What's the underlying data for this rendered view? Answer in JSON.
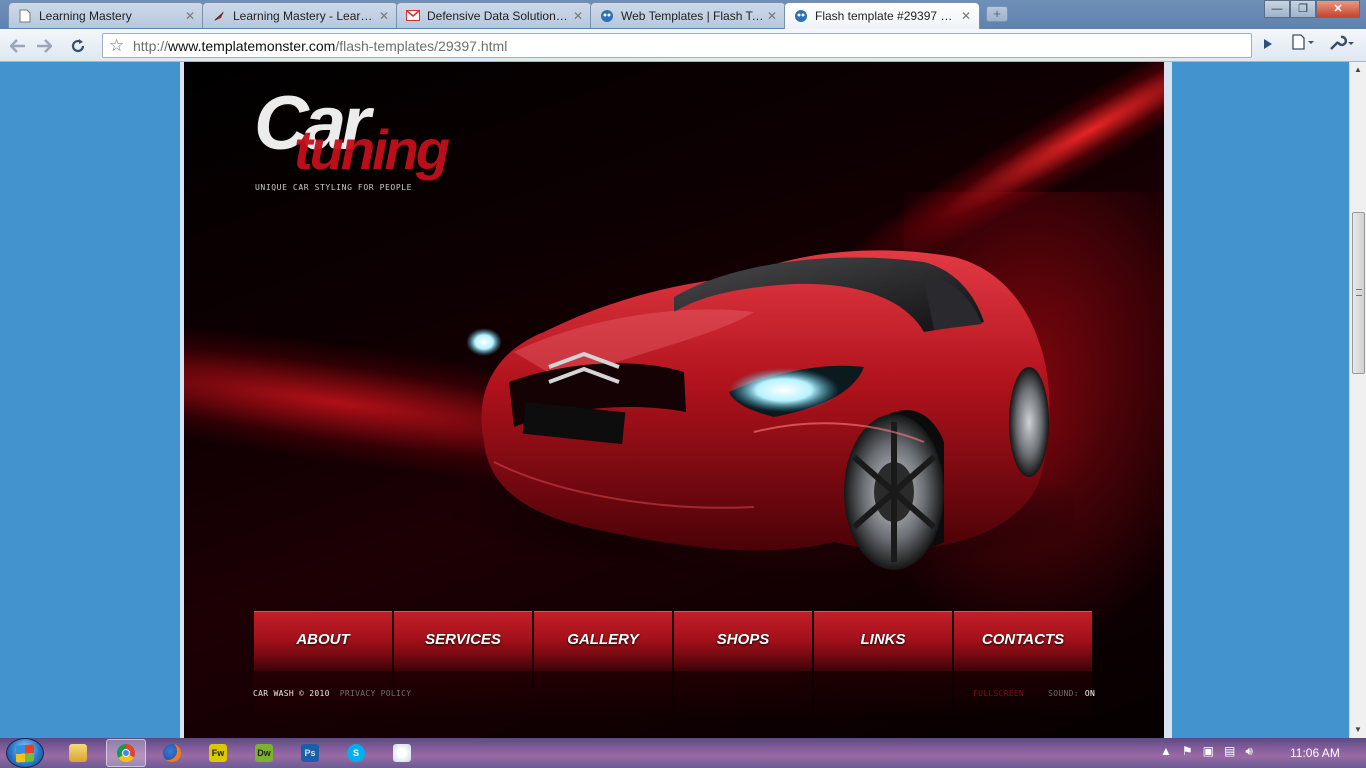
{
  "browser": {
    "tabs": [
      {
        "title": "Learning Mastery",
        "favicon": "document-icon"
      },
      {
        "title": "Learning Mastery - Learni...",
        "favicon": "feather-icon"
      },
      {
        "title": "Defensive Data Solutions ...",
        "favicon": "gmail-icon"
      },
      {
        "title": "Web Templates | Flash Te...",
        "favicon": "templatemonster-icon"
      },
      {
        "title": "Flash template #29397 by...",
        "favicon": "templatemonster-icon",
        "active": true
      }
    ],
    "new_tab_symbol": "+",
    "window_controls": {
      "minimize": "—",
      "maximize": "❐",
      "close": "✕"
    },
    "url": {
      "scheme": "http://",
      "host": "www.templatemonster.com",
      "path": "/flash-templates/29397.html"
    }
  },
  "site": {
    "logo_word_1": "Car",
    "logo_word_2": "tuning",
    "tagline": "UNIQUE CAR STYLING FOR  PEOPLE",
    "menu": [
      {
        "label": "ABOUT"
      },
      {
        "label": "SERVICES"
      },
      {
        "label": "GALLERY"
      },
      {
        "label": "SHOPS"
      },
      {
        "label": "LINKS"
      },
      {
        "label": "CONTACTS"
      }
    ],
    "footer": {
      "copyright": "CAR WASH © 2010",
      "privacy": "PRIVACY POLICY",
      "fullscreen": "FULLSCREEN",
      "sound_label": "SOUND:",
      "sound_value": "ON"
    },
    "colors": {
      "accent": "#c4101c",
      "page_background": "#4393cf"
    }
  },
  "taskbar": {
    "apps": [
      {
        "name": "windows-explorer",
        "icon": "folder-icon"
      },
      {
        "name": "google-chrome",
        "icon": "chrome-icon",
        "active": true
      },
      {
        "name": "firefox",
        "icon": "firefox-icon"
      },
      {
        "name": "fireworks",
        "icon": "fireworks-icon",
        "text": "Fw"
      },
      {
        "name": "dreamweaver",
        "icon": "dreamweaver-icon",
        "text": "Dw"
      },
      {
        "name": "photoshop",
        "icon": "photoshop-icon",
        "text": "Ps"
      },
      {
        "name": "skype",
        "icon": "skype-icon",
        "text": "S"
      },
      {
        "name": "paint",
        "icon": "paint-icon"
      }
    ],
    "clock": "11:06 AM"
  }
}
